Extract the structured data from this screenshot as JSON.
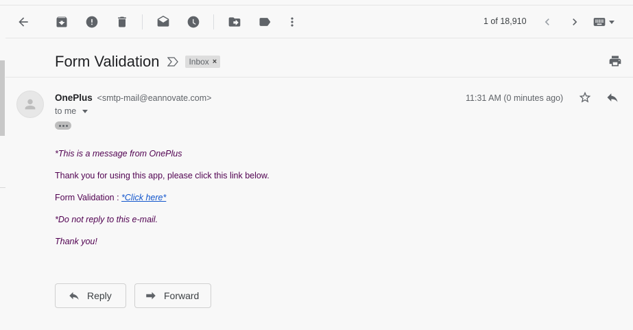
{
  "toolbar": {
    "icons": [
      "back-arrow-icon",
      "archive-icon",
      "report-spam-icon",
      "delete-icon",
      "mark-unread-icon",
      "snooze-icon",
      "move-to-icon",
      "label-icon",
      "more-vert-icon"
    ],
    "pager_text": "1 of 18,910",
    "prev_icon": "chevron-left-icon",
    "next_icon": "chevron-right-icon",
    "input_tools_icon": "keyboard-icon"
  },
  "email": {
    "subject": "Form Validation",
    "label": "Inbox",
    "label_remove": "×",
    "sender_name": "OnePlus",
    "sender_email": "<smtp-mail@eannovate.com>",
    "recipient": "to me",
    "timestamp": "11:31 AM (0 minutes ago)",
    "body": {
      "line1": "*This is a message from OnePlus",
      "line2": "Thank you for using this app, please click this link below.",
      "line3_prefix": "Form Validation : ",
      "line3_link": "*Click here*",
      "line4": "*Do not reply to this e-mail.",
      "line5": "Thank you!"
    }
  },
  "actions": {
    "reply_label": "Reply",
    "forward_label": "Forward"
  },
  "colors": {
    "body_text": "#500050",
    "link": "#1155cc",
    "icon": "#5f6368"
  }
}
